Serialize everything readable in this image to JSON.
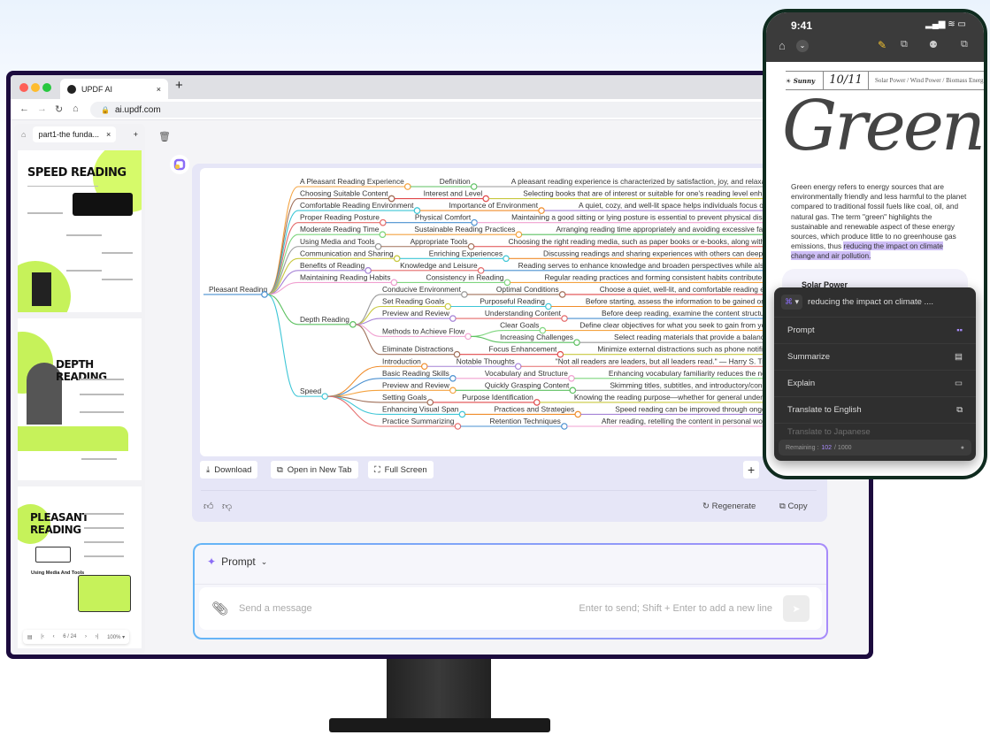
{
  "browser": {
    "tab_title": "UPDF AI",
    "url": "ai.updf.com",
    "new_tab": "+",
    "close": "×"
  },
  "sidebar": {
    "doc_tab": "part1-the funda...",
    "add": "+",
    "close": "×",
    "pages": [
      {
        "title": "SPEED READING"
      },
      {
        "title": "DEPTH READING"
      },
      {
        "title": "PLEASANT READING",
        "subtitle": "Using Media And Tools"
      }
    ],
    "pager": {
      "page": "6 / 24",
      "zoom": "100%"
    }
  },
  "mindmap": {
    "palette": [
      "#f4a340",
      "#5cc160",
      "#9a9a9a",
      "#a0705a",
      "#e0484a",
      "#c8c83e",
      "#3dc6d6",
      "#f08c2a",
      "#a582d6",
      "#e56b6b",
      "#4a90d0",
      "#f0a0d0",
      "#7fd67f"
    ],
    "root": "Pleasant Reading",
    "children": [
      {
        "label": "A Pleasant Reading Experience",
        "children": [
          {
            "label": "Definition",
            "children": [
              {
                "label": "A pleasant reading experience is characterized by satisfaction, joy, and relaxation during read"
              }
            ]
          }
        ]
      },
      {
        "label": "Choosing Suitable Content",
        "children": [
          {
            "label": "Interest and Level",
            "children": [
              {
                "label": "Selecting books that are of interest or suitable for one's reading level enhances the readin"
              }
            ]
          }
        ]
      },
      {
        "label": "Comfortable Reading Environment",
        "children": [
          {
            "label": "Importance of Environment",
            "children": [
              {
                "label": "A quiet, cozy, and well-lit space helps individuals focus on reading and r"
              }
            ]
          }
        ]
      },
      {
        "label": "Proper Reading Posture",
        "children": [
          {
            "label": "Physical Comfort",
            "children": [
              {
                "label": "Maintaining a good sitting or lying posture is essential to prevent physical discomfort and fatig"
              }
            ]
          }
        ]
      },
      {
        "label": "Moderate Reading Time",
        "children": [
          {
            "label": "Sustainable Reading Practices",
            "children": [
              {
                "label": "Arranging reading time appropriately and avoiding excessive fatigue helps to s"
              }
            ]
          }
        ]
      },
      {
        "label": "Using Media and Tools",
        "children": [
          {
            "label": "Appropriate Tools",
            "children": [
              {
                "label": "Choosing the right reading media, such as paper books or e-books, along with tools like book"
              }
            ]
          }
        ]
      },
      {
        "label": "Communication and Sharing",
        "children": [
          {
            "label": "Enriching Experiences",
            "children": [
              {
                "label": "Discussing readings and sharing experiences with others can deepen the understan"
              }
            ]
          }
        ]
      },
      {
        "label": "Benefits of Reading",
        "children": [
          {
            "label": "Knowledge and Leisure",
            "children": [
              {
                "label": "Reading serves to enhance knowledge and broaden perspectives while also being a signif"
              }
            ]
          }
        ]
      },
      {
        "label": "Maintaining Reading Habits",
        "children": [
          {
            "label": "Consistency in Reading",
            "children": [
              {
                "label": "Regular reading practices and forming consistent habits contribute to a continuous"
              }
            ]
          }
        ]
      },
      {
        "label": "Depth Reading",
        "children": [
          {
            "label": "Conducive Environment",
            "children": [
              {
                "label": "Optimal Conditions",
                "children": [
                  {
                    "label": "Choose a quiet, well-lit, and comfortable reading environment t"
                  }
                ]
              }
            ]
          },
          {
            "label": "Set Reading Goals",
            "children": [
              {
                "label": "Purposeful Reading",
                "children": [
                  {
                    "label": "Before starting, assess the information to be gained or the objective"
                  }
                ]
              }
            ]
          },
          {
            "label": "Preview and Review",
            "children": [
              {
                "label": "Understanding Content",
                "children": [
                  {
                    "label": "Before deep reading, examine the content structure (table of c"
                  }
                ]
              }
            ]
          },
          {
            "label": "Methods to Achieve Flow",
            "children": [
              {
                "label": "Clear Goals",
                "children": [
                  {
                    "label": "Define clear objectives for what you seek to gain from your reading."
                  }
                ]
              },
              {
                "label": "Increasing Challenges",
                "children": [
                  {
                    "label": "Select reading materials that provide a balance of challeng"
                  }
                ]
              }
            ]
          },
          {
            "label": "Eliminate Distractions",
            "children": [
              {
                "label": "Focus Enhancement",
                "children": [
                  {
                    "label": "Minimize external distractions such as phone notifications or co"
                  }
                ]
              }
            ]
          }
        ]
      },
      {
        "label": "Speed",
        "children": [
          {
            "label": "Introduction",
            "children": [
              {
                "label": "Notable Thoughts",
                "children": [
                  {
                    "label": "\"Not all readers are leaders, but all leaders read.\" — Harry S. Truman empha"
                  }
                ]
              }
            ]
          },
          {
            "label": "Basic Reading Skills",
            "children": [
              {
                "label": "Vocabulary and Structure",
                "children": [
                  {
                    "label": "Enhancing vocabulary familiarity reduces the need for frequ"
                  }
                ]
              }
            ]
          },
          {
            "label": "Preview and Review",
            "children": [
              {
                "label": "Quickly Grasping Content",
                "children": [
                  {
                    "label": "Skimming titles, subtitles, and introductory/concluding parag"
                  }
                ]
              }
            ]
          },
          {
            "label": "Setting Goals",
            "children": [
              {
                "label": "Purpose Identification",
                "children": [
                  {
                    "label": "Knowing the reading purpose—whether for general understanding, sp"
                  }
                ]
              }
            ]
          },
          {
            "label": "Enhancing Visual Span",
            "children": [
              {
                "label": "Practices and Strategies",
                "children": [
                  {
                    "label": "Speed reading can be improved through ongoing practice"
                  }
                ]
              }
            ]
          },
          {
            "label": "Practice Summarizing",
            "children": [
              {
                "label": "Retention Techniques",
                "children": [
                  {
                    "label": "After reading, retelling the content in personal words can boo"
                  }
                ]
              }
            ]
          }
        ]
      }
    ]
  },
  "actions": {
    "download": "Download",
    "open_new_tab": "Open in New Tab",
    "full_screen": "Full Screen",
    "add": "+",
    "regenerate": "Regenerate",
    "copy": "Copy"
  },
  "composer": {
    "mode": "Prompt",
    "placeholder": "Send a message",
    "hint": "Enter to send; Shift + Enter to add a new line"
  },
  "phone": {
    "time": "9:41",
    "weather": "Sunny",
    "date": "10/11",
    "topics": "Solar Power / Wind Power / Biomass Energ",
    "heading": "Green",
    "paragraph": "Green energy refers to energy sources that are environmentally friendly and less harmful to the planet compared to traditional fossil fuels like coal, oil, and natural gas. The term \"green\" highlights the sustainable and renewable aspect of these energy sources, which produce little to no greenhouse gas emissions, thus ",
    "highlight": "reducing the impact on climate change and air pollution.",
    "card_title": "Solar Power",
    "popup": {
      "selection": "reducing the impact on climate ....",
      "items": [
        "Prompt",
        "Summarize",
        "Explain",
        "Translate to English",
        "Translate to Japanese"
      ],
      "remaining_label": "Remaining :",
      "remaining_used": "102",
      "remaining_total": "/ 1000",
      "accent": "#a78bfa"
    }
  }
}
